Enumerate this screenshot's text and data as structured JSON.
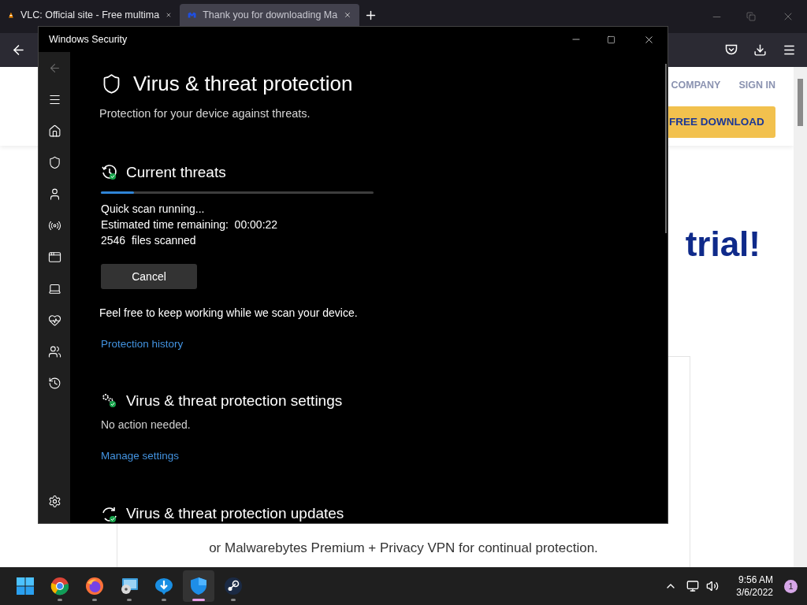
{
  "browser": {
    "tabs": [
      {
        "title": "VLC: Official site - Free multima",
        "kind": "cone",
        "selected": false
      },
      {
        "title": "Thank you for downloading Ma",
        "kind": "brand",
        "selected": true
      }
    ]
  },
  "page": {
    "nav_links": [
      "COMPANY",
      "SIGN IN"
    ],
    "cta": "FREE DOWNLOAD",
    "headline": "trial!",
    "body": "or Malwarebytes Premium + Privacy VPN for continual protection."
  },
  "security_window": {
    "title": "Windows Security",
    "heading": "Virus & threat protection",
    "subtitle": "Protection for your device against threats.",
    "current_threats": {
      "title": "Current threats",
      "level": 0.12,
      "status_lines": [
        "Quick scan running...",
        "Estimated time remaining:  00:00:22",
        "2546  files scanned"
      ],
      "cancel_button": "Cancel",
      "note": "Feel free to keep working while we scan your device.",
      "link": "Protection history"
    },
    "settings_section": {
      "title": "Virus & threat protection settings",
      "status": "No action needed.",
      "link": "Manage settings"
    },
    "updates_section": {
      "title": "Virus & threat protection updates"
    }
  },
  "taskbar": {
    "apps": [
      {
        "kind": "start",
        "selected": false
      },
      {
        "kind": "chrome",
        "selected": false
      },
      {
        "kind": "firefox",
        "selected": false
      },
      {
        "kind": "disc",
        "selected": false
      },
      {
        "kind": "download",
        "selected": false
      },
      {
        "kind": "shield",
        "selected": true
      },
      {
        "kind": "steam",
        "selected": false
      }
    ],
    "time": "9:56 AM",
    "date": "3/6/2022",
    "notifications": "1"
  }
}
